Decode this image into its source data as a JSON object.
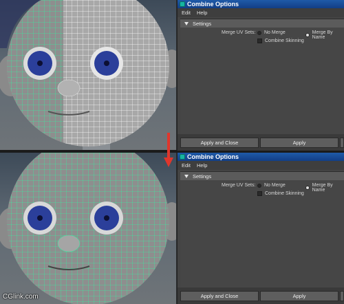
{
  "windows": [
    {
      "title": "Combine Options",
      "menu": [
        "Edit",
        "Help"
      ],
      "section_title": "Settings",
      "merge_uv_label": "Merge UV Sets:",
      "option_no_merge": "No Merge",
      "option_merge_by_name": "Merge By Name",
      "selected_option": "Merge By Name",
      "combine_skinning_label": "Combine Skinning",
      "combine_skinning_checked": false,
      "buttons": {
        "apply_close": "Apply and Close",
        "apply": "Apply"
      }
    },
    {
      "title": "Combine Options",
      "menu": [
        "Edit",
        "Help"
      ],
      "section_title": "Settings",
      "merge_uv_label": "Merge UV Sets:",
      "option_no_merge": "No Merge",
      "option_merge_by_name": "Merge By Name",
      "selected_option": "Merge By Name",
      "combine_skinning_label": "Combine Skinning",
      "combine_skinning_checked": false,
      "buttons": {
        "apply_close": "Apply and Close",
        "apply": "Apply"
      }
    }
  ],
  "watermark": "CGlink.com",
  "colors": {
    "wire_selected": "#3ee6a0",
    "wire_unselected": "#ffffff",
    "arrow": "#e0362c",
    "titlebar": "#1f5aa8",
    "eye_iris": "#2b3f9a"
  },
  "icons": {
    "arrow": "arrow-down-icon",
    "app": "maya-app-icon",
    "collapse": "collapse-triangle-icon"
  }
}
